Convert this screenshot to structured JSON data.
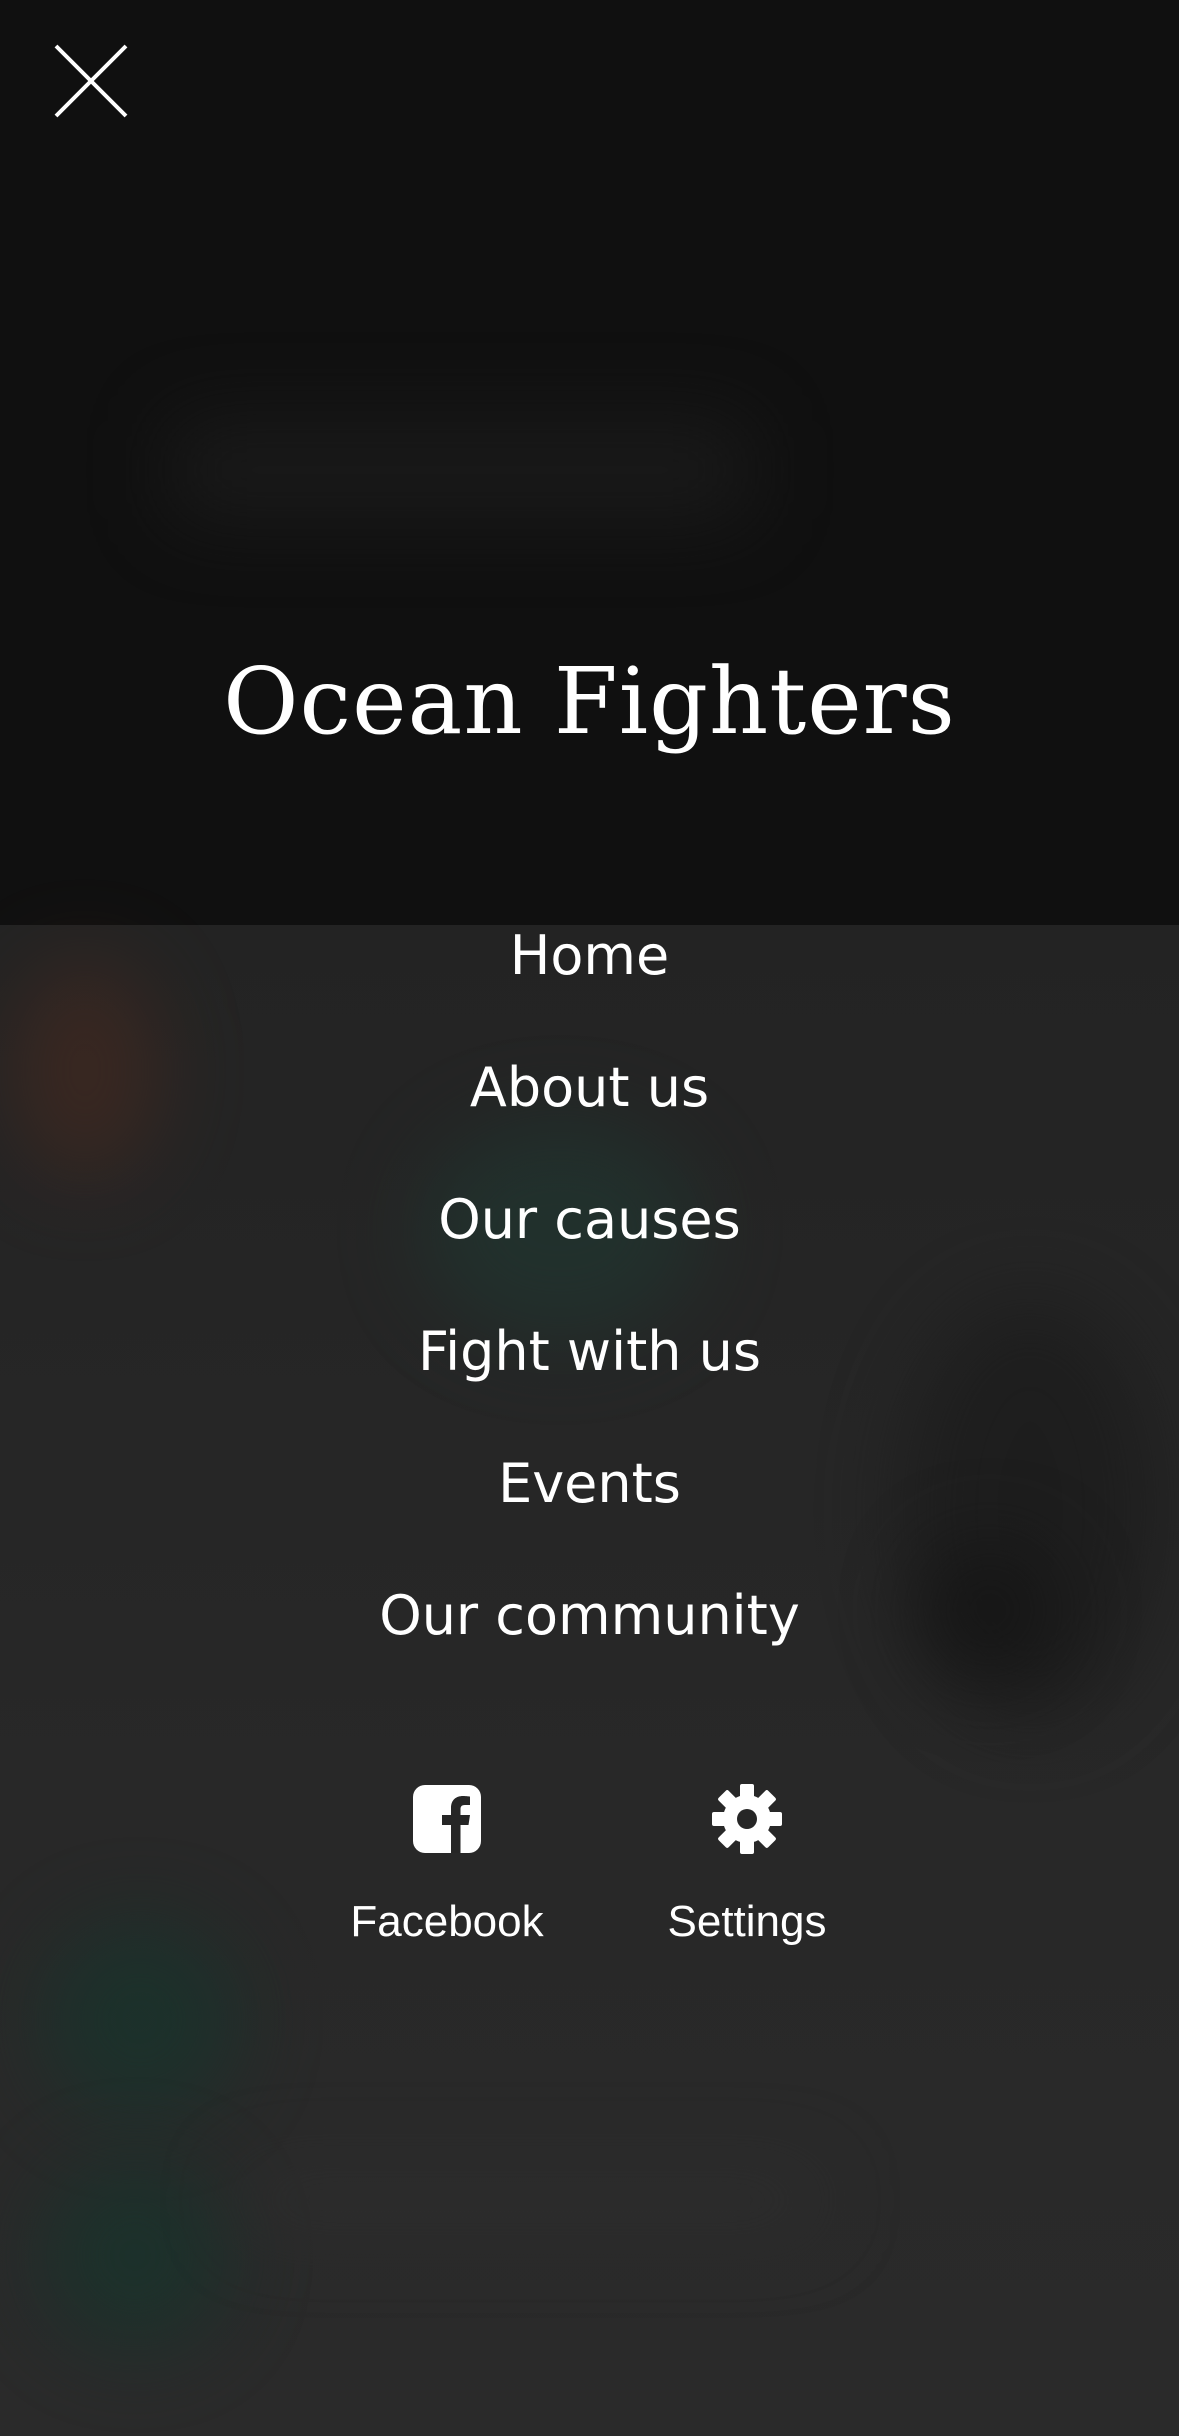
{
  "brand": {
    "title": "Ocean Fighters"
  },
  "close_button": {
    "icon": "close-icon"
  },
  "menu": {
    "items": [
      {
        "label": "Home"
      },
      {
        "label": "About us"
      },
      {
        "label": "Our causes"
      },
      {
        "label": "Fight with us"
      },
      {
        "label": "Events"
      },
      {
        "label": "Our community"
      }
    ]
  },
  "actions": [
    {
      "label": "Facebook",
      "icon": "facebook-icon"
    },
    {
      "label": "Settings",
      "icon": "gear-icon"
    }
  ],
  "colors": {
    "overlay_top": "#101010",
    "overlay_bottom": "#262626",
    "text": "#ffffff"
  }
}
